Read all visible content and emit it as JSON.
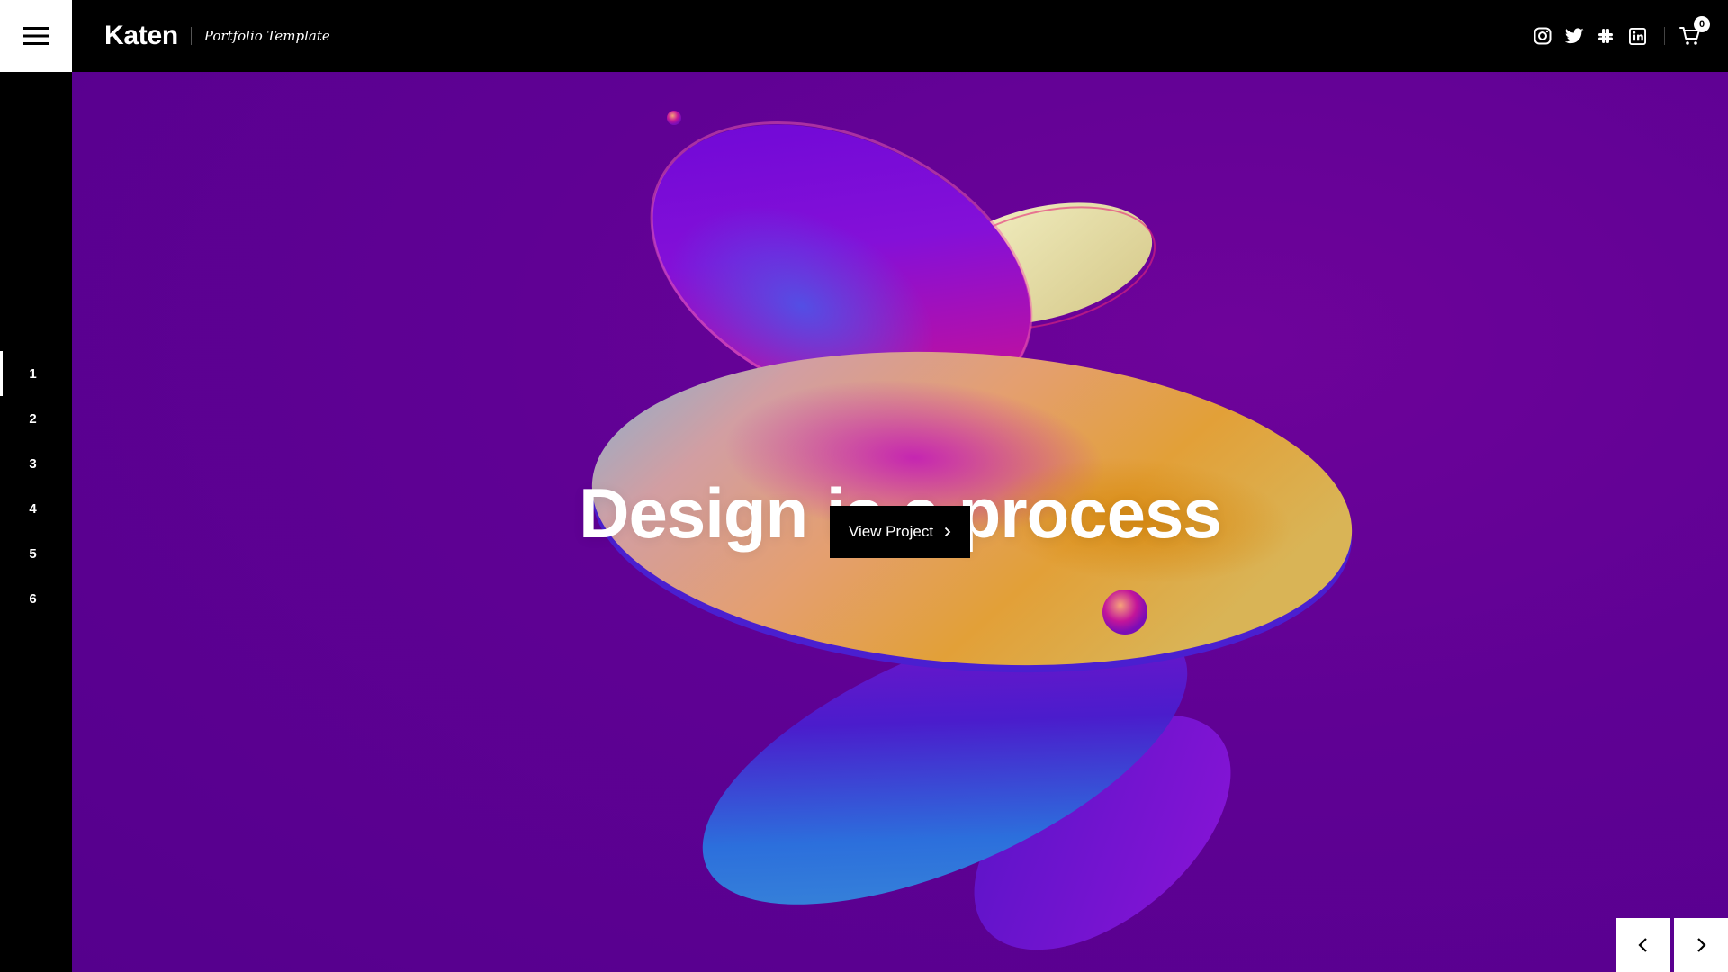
{
  "header": {
    "logo": "Katen",
    "tagline": "Portfolio Template",
    "menu_icon": "hamburger-icon",
    "social": [
      {
        "name": "instagram",
        "icon": "instagram-icon"
      },
      {
        "name": "twitter",
        "icon": "twitter-icon"
      },
      {
        "name": "slack",
        "icon": "slack-icon"
      },
      {
        "name": "linkedin",
        "icon": "linkedin-icon"
      }
    ],
    "cart": {
      "icon": "cart-icon",
      "count": "0"
    }
  },
  "slides": {
    "items": [
      "1",
      "2",
      "3",
      "4",
      "5",
      "6"
    ],
    "active": 1
  },
  "hero": {
    "headline": "Design is a process",
    "cta_label": "View Project",
    "cta_icon": "chevron-right-icon",
    "prev_icon": "chevron-left-icon",
    "next_icon": "chevron-right-icon",
    "background_color": "#5f0194"
  },
  "colors": {
    "header_bg": "#000000",
    "accent": "#ffffff",
    "hero_purple": "#5f0194"
  }
}
